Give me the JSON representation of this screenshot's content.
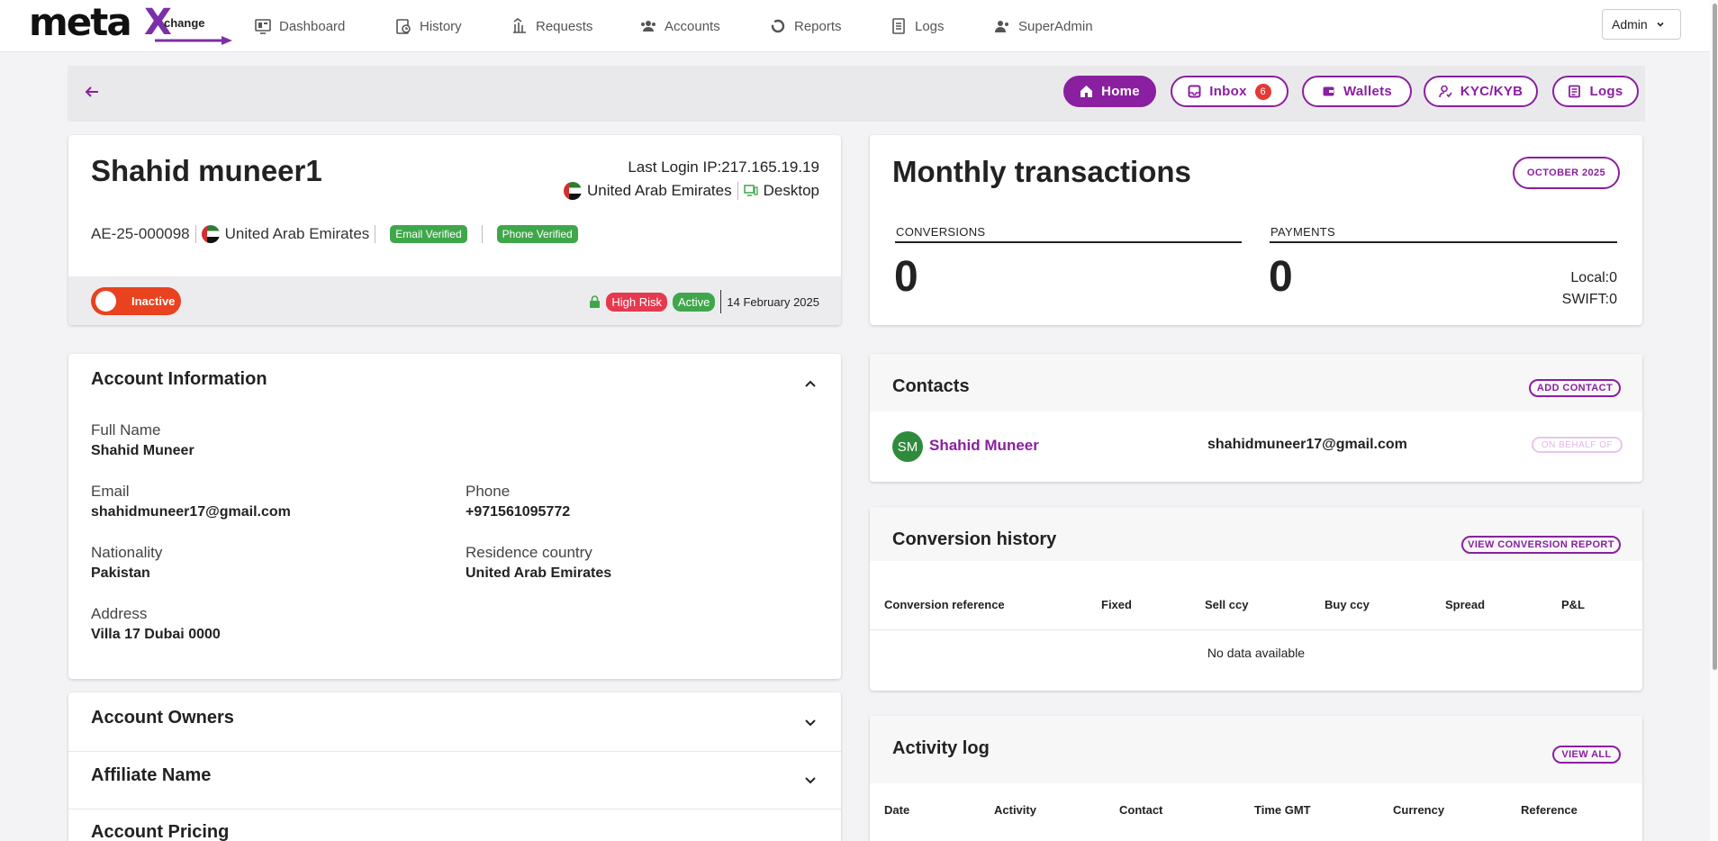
{
  "brand": {
    "logo_main": "meta",
    "logo_x": "X",
    "logo_sub": "change"
  },
  "nav": [
    {
      "label": "Dashboard",
      "icon": "dashboard-icon"
    },
    {
      "label": "History",
      "icon": "history-icon"
    },
    {
      "label": "Requests",
      "icon": "requests-icon"
    },
    {
      "label": "Accounts",
      "icon": "accounts-icon"
    },
    {
      "label": "Reports",
      "icon": "reports-icon"
    },
    {
      "label": "Logs",
      "icon": "logs-icon"
    },
    {
      "label": "SuperAdmin",
      "icon": "superadmin-icon"
    }
  ],
  "admin_menu": {
    "label": "Admin"
  },
  "toolbar": {
    "home": "Home",
    "inbox": "Inbox",
    "inbox_count": "6",
    "wallets": "Wallets",
    "kyc": "KYC/KYB",
    "logs": "Logs"
  },
  "profile": {
    "name": "Shahid muneer1",
    "last_login": "Last Login IP:217.165.19.19",
    "login_country": "United Arab Emirates",
    "login_device": "Desktop",
    "account_id": "AE-25-000098",
    "country": "United Arab Emirates",
    "email_badge": "Email Verified",
    "phone_badge": "Phone Verified",
    "toggle_label": "Inactive",
    "risk_badge": "High Risk",
    "status_badge": "Active",
    "date": "14 February 2025"
  },
  "account_info": {
    "title": "Account Information",
    "full_name_label": "Full Name",
    "full_name": "Shahid Muneer",
    "email_label": "Email",
    "email": "shahidmuneer17@gmail.com",
    "phone_label": "Phone",
    "phone": "+971561095772",
    "nationality_label": "Nationality",
    "nationality": "Pakistan",
    "residence_label": "Residence country",
    "residence": "United Arab Emirates",
    "address_label": "Address",
    "address": "Villa 17 Dubai 0000"
  },
  "collapsed_sections": {
    "owners": "Account Owners",
    "affiliate": "Affiliate Name",
    "pricing": "Account Pricing"
  },
  "monthly": {
    "title": "Monthly transactions",
    "period": "OCTOBER 2025",
    "conversions_label": "CONVERSIONS",
    "conversions_value": "0",
    "payments_label": "PAYMENTS",
    "payments_value": "0",
    "local": "Local:0",
    "swift": "SWIFT:0"
  },
  "contacts": {
    "title": "Contacts",
    "add_button": "ADD CONTACT",
    "items": [
      {
        "initials": "SM",
        "name": "Shahid Muneer",
        "email": "shahidmuneer17@gmail.com",
        "action": "ON BEHALF OF"
      }
    ]
  },
  "conversion_history": {
    "title": "Conversion history",
    "report_button": "VIEW CONVERSION REPORT",
    "columns": [
      "Conversion reference",
      "Fixed",
      "Sell ccy",
      "Buy ccy",
      "Spread",
      "P&L"
    ],
    "empty": "No data available"
  },
  "activity_log": {
    "title": "Activity log",
    "view_all": "VIEW ALL",
    "columns": [
      "Date",
      "Activity",
      "Contact",
      "Time GMT",
      "Currency",
      "Reference"
    ]
  },
  "colors": {
    "brand": "#8a1fa0",
    "danger": "#e53950",
    "success": "#3fa74a",
    "toggle": "#e8421f"
  }
}
